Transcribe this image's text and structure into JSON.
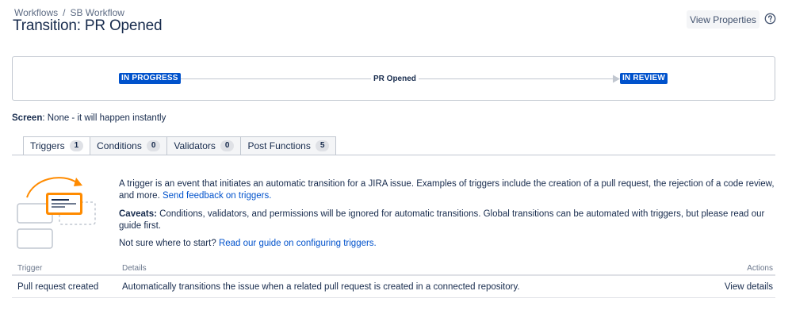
{
  "breadcrumb": {
    "items": [
      "Workflows",
      "SB Workflow"
    ],
    "separator": "/"
  },
  "page": {
    "title": "Transition: PR Opened"
  },
  "header": {
    "view_properties_label": "View Properties",
    "help_icon": "question-circle-icon"
  },
  "diagram": {
    "from_status": "IN PROGRESS",
    "transition": "PR Opened",
    "to_status": "IN REVIEW",
    "status_color": "#0052cc"
  },
  "screen": {
    "label": "Screen",
    "value": ": None - it will happen instantly"
  },
  "tabs": [
    {
      "label": "Triggers",
      "count": "1",
      "active": true
    },
    {
      "label": "Conditions",
      "count": "0",
      "active": false
    },
    {
      "label": "Validators",
      "count": "0",
      "active": false
    },
    {
      "label": "Post Functions",
      "count": "5",
      "active": false
    }
  ],
  "triggers_info": {
    "intro": "A trigger is an event that initiates an automatic transition for a JIRA issue. Examples of triggers include the creation of a pull request, the rejection of a code review, and more.",
    "feedback_link": "Send feedback on triggers.",
    "caveats_label": "Caveats:",
    "caveats_text": "Conditions, validators, and permissions will be ignored for automatic transitions. Global transitions can be automated with triggers, but please read our guide first.",
    "guide_prompt": "Not sure where to start?",
    "guide_link": "Read our guide on configuring triggers."
  },
  "table": {
    "headers": {
      "trigger": "Trigger",
      "details": "Details",
      "actions": "Actions"
    },
    "rows": [
      {
        "trigger": "Pull request created",
        "details": "Automatically transitions the issue when a related pull request is created in a connected repository.",
        "action": "View details"
      }
    ]
  },
  "colors": {
    "accent": "#0052cc",
    "illustration_orange": "#ff8b00",
    "text": "#172b4d"
  }
}
